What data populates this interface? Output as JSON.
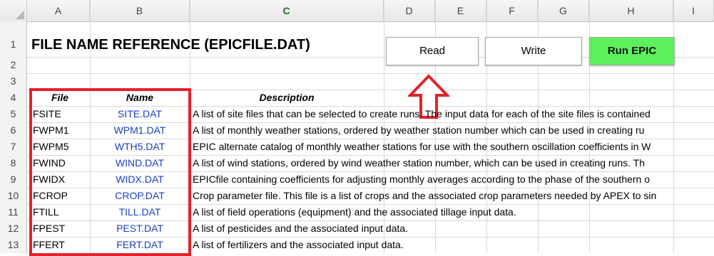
{
  "columns": [
    "A",
    "B",
    "C",
    "D",
    "E",
    "F",
    "G",
    "H",
    "I"
  ],
  "active_column": "C",
  "rows": [
    "1",
    "2",
    "3",
    "4",
    "5",
    "6",
    "7",
    "8",
    "9",
    "10",
    "11",
    "12",
    "13"
  ],
  "title": "FILE NAME REFERENCE (EPICFILE.DAT)",
  "buttons": {
    "read": "Read",
    "write": "Write",
    "run": "Run EPIC"
  },
  "table": {
    "headers": [
      "File",
      "Name",
      "Description"
    ],
    "rows": [
      {
        "file": "FSITE",
        "name": "SITE.DAT",
        "description": "A list of site files that can be selected to create runs.  The input data for each of the site files is contained"
      },
      {
        "file": "FWPM1",
        "name": "WPM1.DAT",
        "description": "A list of monthly weather stations, ordered by weather station number which can be used in creating ru"
      },
      {
        "file": "FWPM5",
        "name": "WTH5.DAT",
        "description": "EPIC alternate catalog of monthly weather stations for use with the southern oscillation coefficients in W"
      },
      {
        "file": "FWIND",
        "name": "WIND.DAT",
        "description": "A list of wind stations, ordered by wind weather station number, which can be used in creating runs.  Th"
      },
      {
        "file": "FWIDX",
        "name": "WIDX.DAT",
        "description": "EPICfile containing coefficients for adjusting monthly averages according to the phase of the southern o"
      },
      {
        "file": "FCROP",
        "name": "CROP.DAT",
        "description": "Crop parameter file.  This file is a list of crops and the associated crop parameters needed by APEX to sin"
      },
      {
        "file": "FTILL",
        "name": "TILL.DAT",
        "description": "A list of field operations (equipment) and the associated tillage input data."
      },
      {
        "file": "FPEST",
        "name": "PEST.DAT",
        "description": "A list of pesticides and the associated input data."
      },
      {
        "file": "FFERT",
        "name": "FERT.DAT",
        "description": "A list of fertilizers and the associated input data."
      }
    ]
  },
  "colors": {
    "name_text": "#1a3fc4",
    "highlight": "#e2222a",
    "run_button": "#5df05d"
  }
}
